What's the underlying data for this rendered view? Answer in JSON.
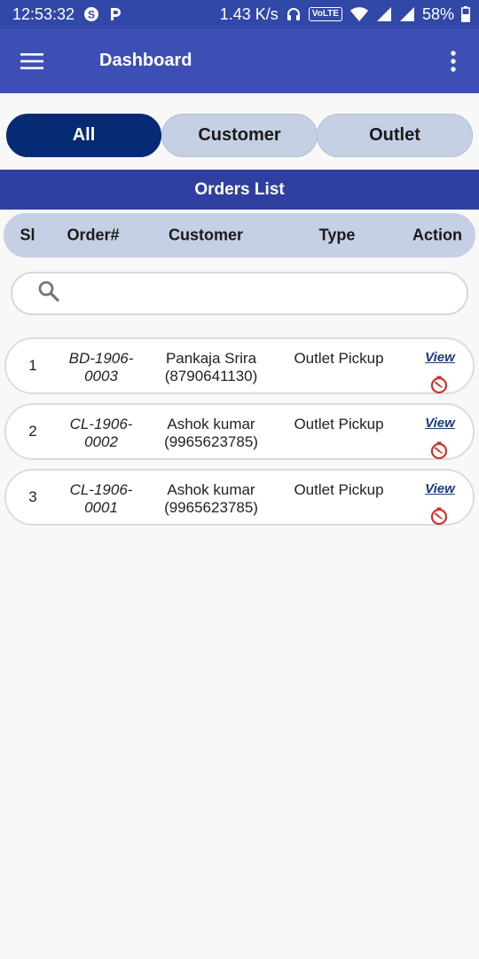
{
  "status_bar": {
    "time": "12:53:32",
    "network_speed": "1.43 K/s",
    "volte": "VoLTE",
    "battery": "58%",
    "icons": [
      "skype-icon",
      "paytm-icon",
      "headset-icon",
      "volte-badge",
      "wifi-icon",
      "signal-icon",
      "signal-icon",
      "battery-icon"
    ]
  },
  "appbar": {
    "title": "Dashboard",
    "menu_icon": "hamburger-menu-icon",
    "more_icon": "more-vertical-icon"
  },
  "tabs": [
    {
      "label": "All",
      "active": true
    },
    {
      "label": "Customer",
      "active": false
    },
    {
      "label": "Outlet",
      "active": false
    }
  ],
  "orders_list": {
    "title": "Orders List",
    "columns": [
      "Sl",
      "Order#",
      "Customer",
      "Type",
      "Action"
    ],
    "search": {
      "value": "",
      "placeholder": ""
    },
    "rows": [
      {
        "sl": "1",
        "order_line1": "BD-1906-",
        "order_line2": "0003",
        "customer_name": "Pankaja Srira",
        "customer_phone": "(8790641130)",
        "type": "Outlet Pickup",
        "action": "View"
      },
      {
        "sl": "2",
        "order_line1": "CL-1906-",
        "order_line2": "0002",
        "customer_name": "Ashok kumar",
        "customer_phone": "(9965623785)",
        "type": "Outlet Pickup",
        "action": "View"
      },
      {
        "sl": "3",
        "order_line1": "CL-1906-",
        "order_line2": "0001",
        "customer_name": "Ashok kumar",
        "customer_phone": "(9965623785)",
        "type": "Outlet Pickup",
        "action": "View"
      }
    ]
  },
  "colors": {
    "status_bar": "#3148a8",
    "appbar": "#3d4fb5",
    "tab_active": "#062a74",
    "tab_inactive": "#c5d0e4",
    "orders_header": "#2f3fa0",
    "timer_icon": "#d0312d",
    "view_link": "#1a3a7e"
  }
}
